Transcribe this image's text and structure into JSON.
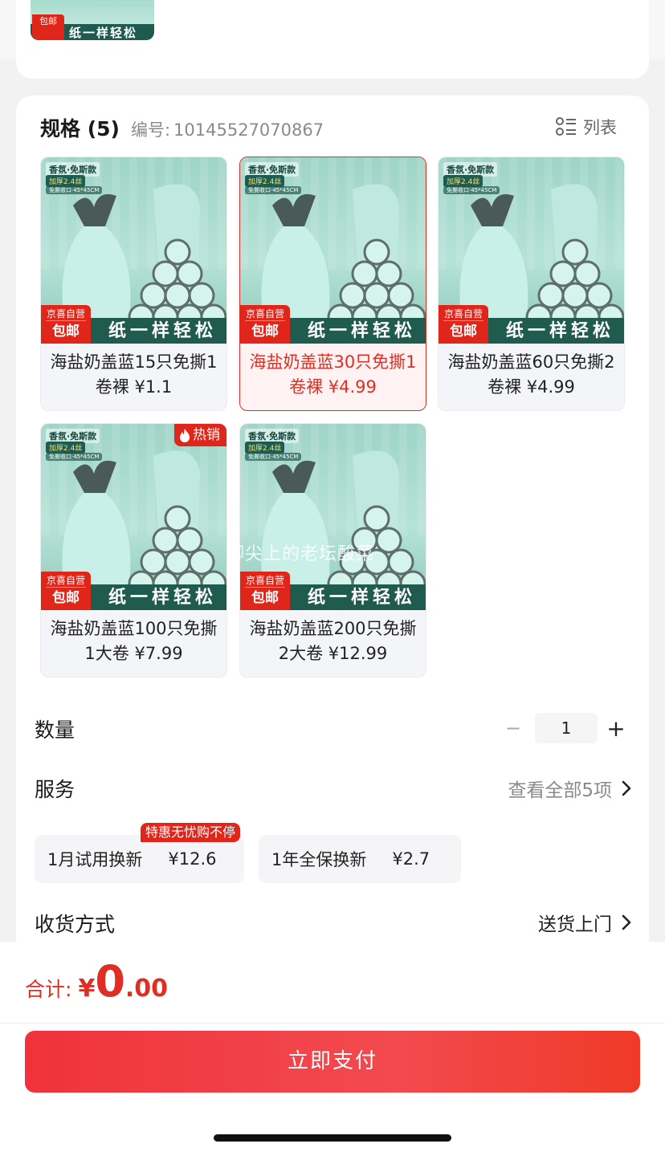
{
  "top_card": {
    "thumb_badge": "包邮",
    "thumb_text": "纸一样轻松"
  },
  "spec": {
    "title": "规格 (5)",
    "code_label": "编号:",
    "code": "10145527070867",
    "view_toggle": "列表"
  },
  "products": [
    {
      "name": "海盐奶盖蓝15只免撕1卷裸 ¥1.1",
      "selected": false,
      "hot": ""
    },
    {
      "name": "海盐奶盖蓝30只免撕1卷裸 ¥4.99",
      "selected": true,
      "hot": ""
    },
    {
      "name": "海盐奶盖蓝60只免撕2卷裸 ¥4.99",
      "selected": false,
      "hot": ""
    },
    {
      "name": "海盐奶盖蓝100只免撕1大卷 ¥7.99",
      "selected": false,
      "hot": "热销"
    },
    {
      "name": "海盐奶盖蓝200只免撕2大卷 ¥12.99",
      "selected": false,
      "hot": ""
    }
  ],
  "product_image": {
    "tag1": "香氛·免斯款",
    "tag2": "加厚2.4丝",
    "tag3": "免撕收口·45*45CM",
    "banner": "纸一样轻松",
    "badge_top": "京喜自营",
    "badge_bottom": "包邮"
  },
  "watermark": "脚尖上的老坛酸菜",
  "quantity": {
    "label": "数量",
    "minus": "−",
    "value": "1",
    "plus": "+"
  },
  "service": {
    "label": "服务",
    "link": "查看全部5项",
    "badge": "特惠无忧购不停",
    "options": [
      {
        "name": "1月试用换新",
        "price": "¥12.6"
      },
      {
        "name": "1年全保换新",
        "price": "¥2.7"
      }
    ]
  },
  "delivery": {
    "label": "收货方式",
    "value": "送货上门"
  },
  "total": {
    "label": "合计:",
    "currency": "¥",
    "integer": "0",
    "decimal": ".00"
  },
  "pay_button": "立即支付",
  "colors": {
    "accent": "#e02e24",
    "product_green": "#1f5b4e"
  }
}
